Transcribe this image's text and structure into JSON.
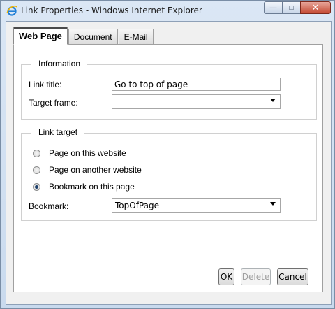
{
  "window": {
    "title": "Link Properties - Windows Internet Explorer",
    "minimize_glyph": "—",
    "maximize_glyph": "□",
    "close_glyph": "✕"
  },
  "tabs": [
    {
      "label": "Web Page",
      "active": true
    },
    {
      "label": "Document",
      "active": false
    },
    {
      "label": "E-Mail",
      "active": false
    }
  ],
  "information": {
    "legend": "Information",
    "link_title_label": "Link title:",
    "link_title_value": "Go to top of page",
    "target_frame_label": "Target frame:",
    "target_frame_value": ""
  },
  "link_target": {
    "legend": "Link target",
    "options": [
      {
        "label": "Page on this website",
        "checked": false
      },
      {
        "label": "Page on another website",
        "checked": false
      },
      {
        "label": "Bookmark on this page",
        "checked": true
      }
    ],
    "bookmark_label": "Bookmark:",
    "bookmark_value": "TopOfPage"
  },
  "buttons": {
    "ok": "OK",
    "delete": "Delete",
    "cancel": "Cancel"
  }
}
